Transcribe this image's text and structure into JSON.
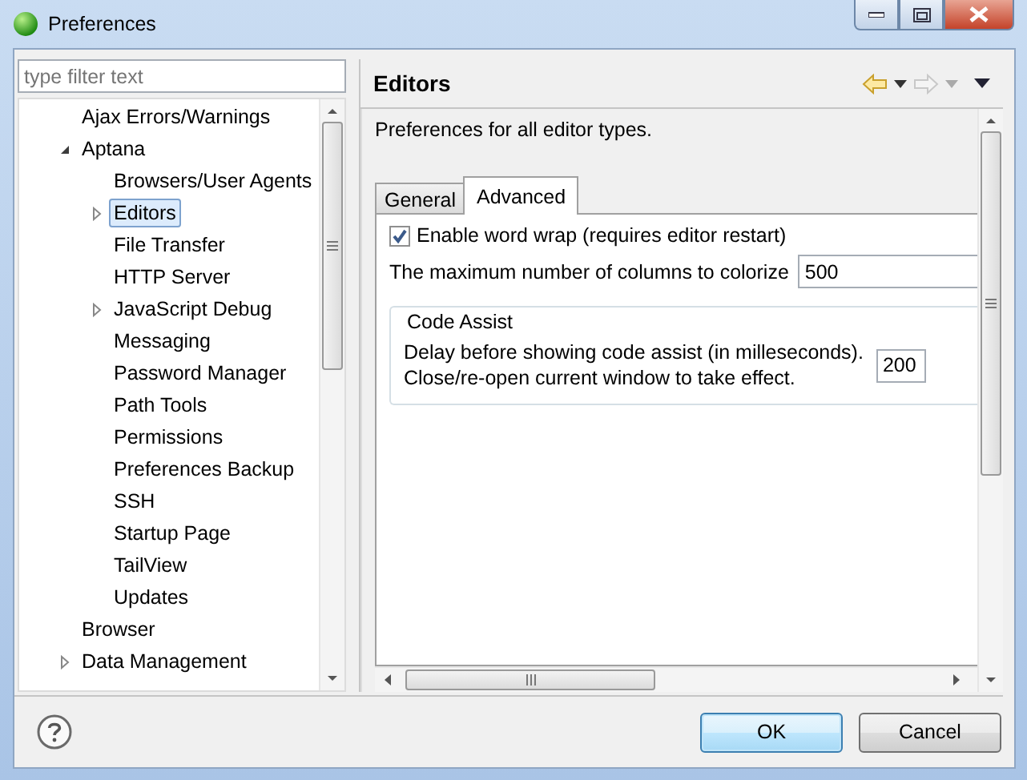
{
  "window": {
    "title": "Preferences"
  },
  "filter": {
    "placeholder": "type filter text"
  },
  "tree": [
    {
      "label": "Ajax Errors/Warnings",
      "selected": false
    },
    {
      "label": "Aptana",
      "selected": false,
      "expanded": true,
      "children": [
        {
          "label": "Browsers/User Agents",
          "selected": false
        },
        {
          "label": "Editors",
          "selected": true,
          "expanded": false
        },
        {
          "label": "File Transfer",
          "selected": false
        },
        {
          "label": "HTTP Server",
          "selected": false
        },
        {
          "label": "JavaScript Debug",
          "selected": false,
          "expanded": false
        },
        {
          "label": "Messaging",
          "selected": false
        },
        {
          "label": "Password Manager",
          "selected": false
        },
        {
          "label": "Path Tools",
          "selected": false
        },
        {
          "label": "Permissions",
          "selected": false
        },
        {
          "label": "Preferences Backup",
          "selected": false
        },
        {
          "label": "SSH",
          "selected": false
        },
        {
          "label": "Startup Page",
          "selected": false
        },
        {
          "label": "TailView",
          "selected": false
        },
        {
          "label": "Updates",
          "selected": false
        }
      ]
    },
    {
      "label": "Browser",
      "selected": false
    },
    {
      "label": "Data Management",
      "selected": false,
      "expanded": false
    }
  ],
  "page": {
    "title": "Editors",
    "description": "Preferences for all editor types.",
    "tabs": [
      {
        "label": "General",
        "selected": false
      },
      {
        "label": "Advanced",
        "selected": true
      }
    ],
    "word_wrap": {
      "label": "Enable word wrap (requires editor restart)",
      "checked": true
    },
    "max_columns": {
      "label": "The maximum number of columns to colorize",
      "value": "500"
    },
    "code_assist": {
      "title": "Code Assist",
      "label_lines": [
        "Delay before showing code assist (in milleseconds).",
        "Close/re-open current window to take effect."
      ],
      "value": "200"
    }
  },
  "buttons": [
    {
      "label": "OK",
      "kind": "default"
    },
    {
      "label": "Cancel",
      "kind": "normal"
    }
  ]
}
